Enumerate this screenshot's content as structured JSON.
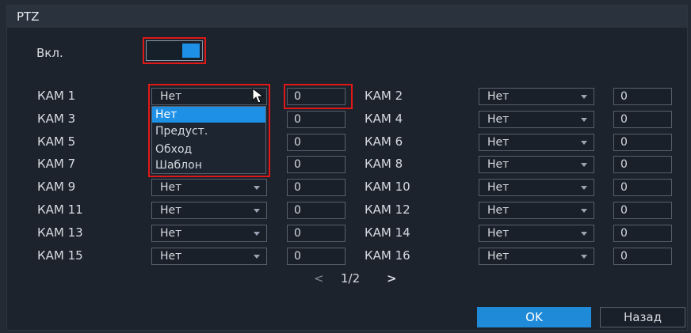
{
  "window": {
    "title": "PTZ"
  },
  "enable": {
    "label": "Вкл."
  },
  "cameras": [
    {
      "name": "КАМ 1",
      "mode": "Нет",
      "value": "0"
    },
    {
      "name": "КАМ 2",
      "mode": "Нет",
      "value": "0"
    },
    {
      "name": "КАМ 3",
      "mode": "Нет",
      "value": "0"
    },
    {
      "name": "КАМ 4",
      "mode": "Нет",
      "value": "0"
    },
    {
      "name": "КАМ 5",
      "mode": "Нет",
      "value": "0"
    },
    {
      "name": "КАМ 6",
      "mode": "Нет",
      "value": "0"
    },
    {
      "name": "КАМ 7",
      "mode": "Нет",
      "value": "0"
    },
    {
      "name": "КАМ 8",
      "mode": "Нет",
      "value": "0"
    },
    {
      "name": "КАМ 9",
      "mode": "Нет",
      "value": "0"
    },
    {
      "name": "КАМ 10",
      "mode": "Нет",
      "value": "0"
    },
    {
      "name": "КАМ 11",
      "mode": "Нет",
      "value": "0"
    },
    {
      "name": "КАМ 12",
      "mode": "Нет",
      "value": "0"
    },
    {
      "name": "КАМ 13",
      "mode": "Нет",
      "value": "0"
    },
    {
      "name": "КАМ 14",
      "mode": "Нет",
      "value": "0"
    },
    {
      "name": "КАМ 15",
      "mode": "Нет",
      "value": "0"
    },
    {
      "name": "КАМ 16",
      "mode": "Нет",
      "value": "0"
    }
  ],
  "dropdown": {
    "options": [
      "Нет",
      "Предуст.",
      "Обход",
      "Шаблон"
    ],
    "selected": "Нет"
  },
  "pager": {
    "prev": "<",
    "page": "1/2",
    "next": ">"
  },
  "buttons": {
    "ok": "OK",
    "back": "Назад"
  },
  "colors": {
    "accent": "#1e90e6",
    "highlight_box": "#e01818"
  },
  "icons": {
    "dropdown_arrow": "chevron-down-icon",
    "cursor": "mouse-pointer-icon"
  }
}
